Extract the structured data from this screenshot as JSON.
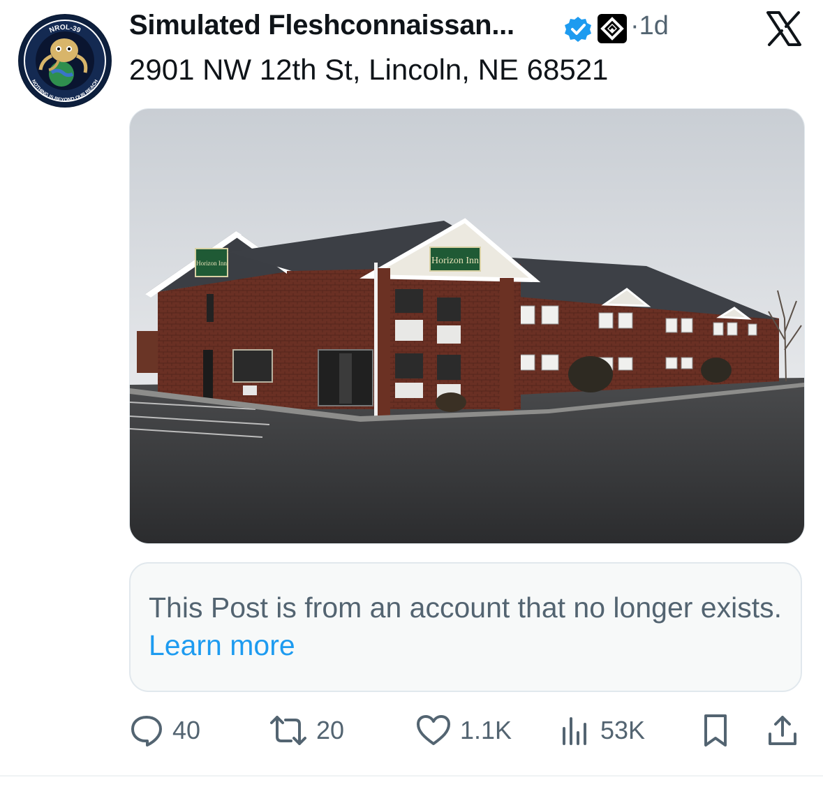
{
  "avatar": {
    "badge_top": "NROL-39",
    "badge_bottom": "NOTHING IS BEYOND OUR REACH"
  },
  "post": {
    "display_name": "Simulated Fleshconnaissan...",
    "timestamp": "1d",
    "separator": "·",
    "text": "2901 NW 12th St, Lincoln, NE 68521"
  },
  "media": {
    "sign_text": "Horizon Inn"
  },
  "notice": {
    "message": "This Post is from an account that no longer exists.",
    "link": "Learn more"
  },
  "actions": {
    "replies": "40",
    "reposts": "20",
    "likes": "1.1K",
    "views": "53K"
  },
  "colors": {
    "accent": "#1d9bf0",
    "secondary_text": "#536471",
    "primary_text": "#0f1419"
  },
  "icons": [
    "verified-badge-icon",
    "affiliate-badge-icon",
    "x-logo-icon",
    "reply-icon",
    "repost-icon",
    "like-icon",
    "views-icon",
    "bookmark-icon",
    "share-icon"
  ]
}
